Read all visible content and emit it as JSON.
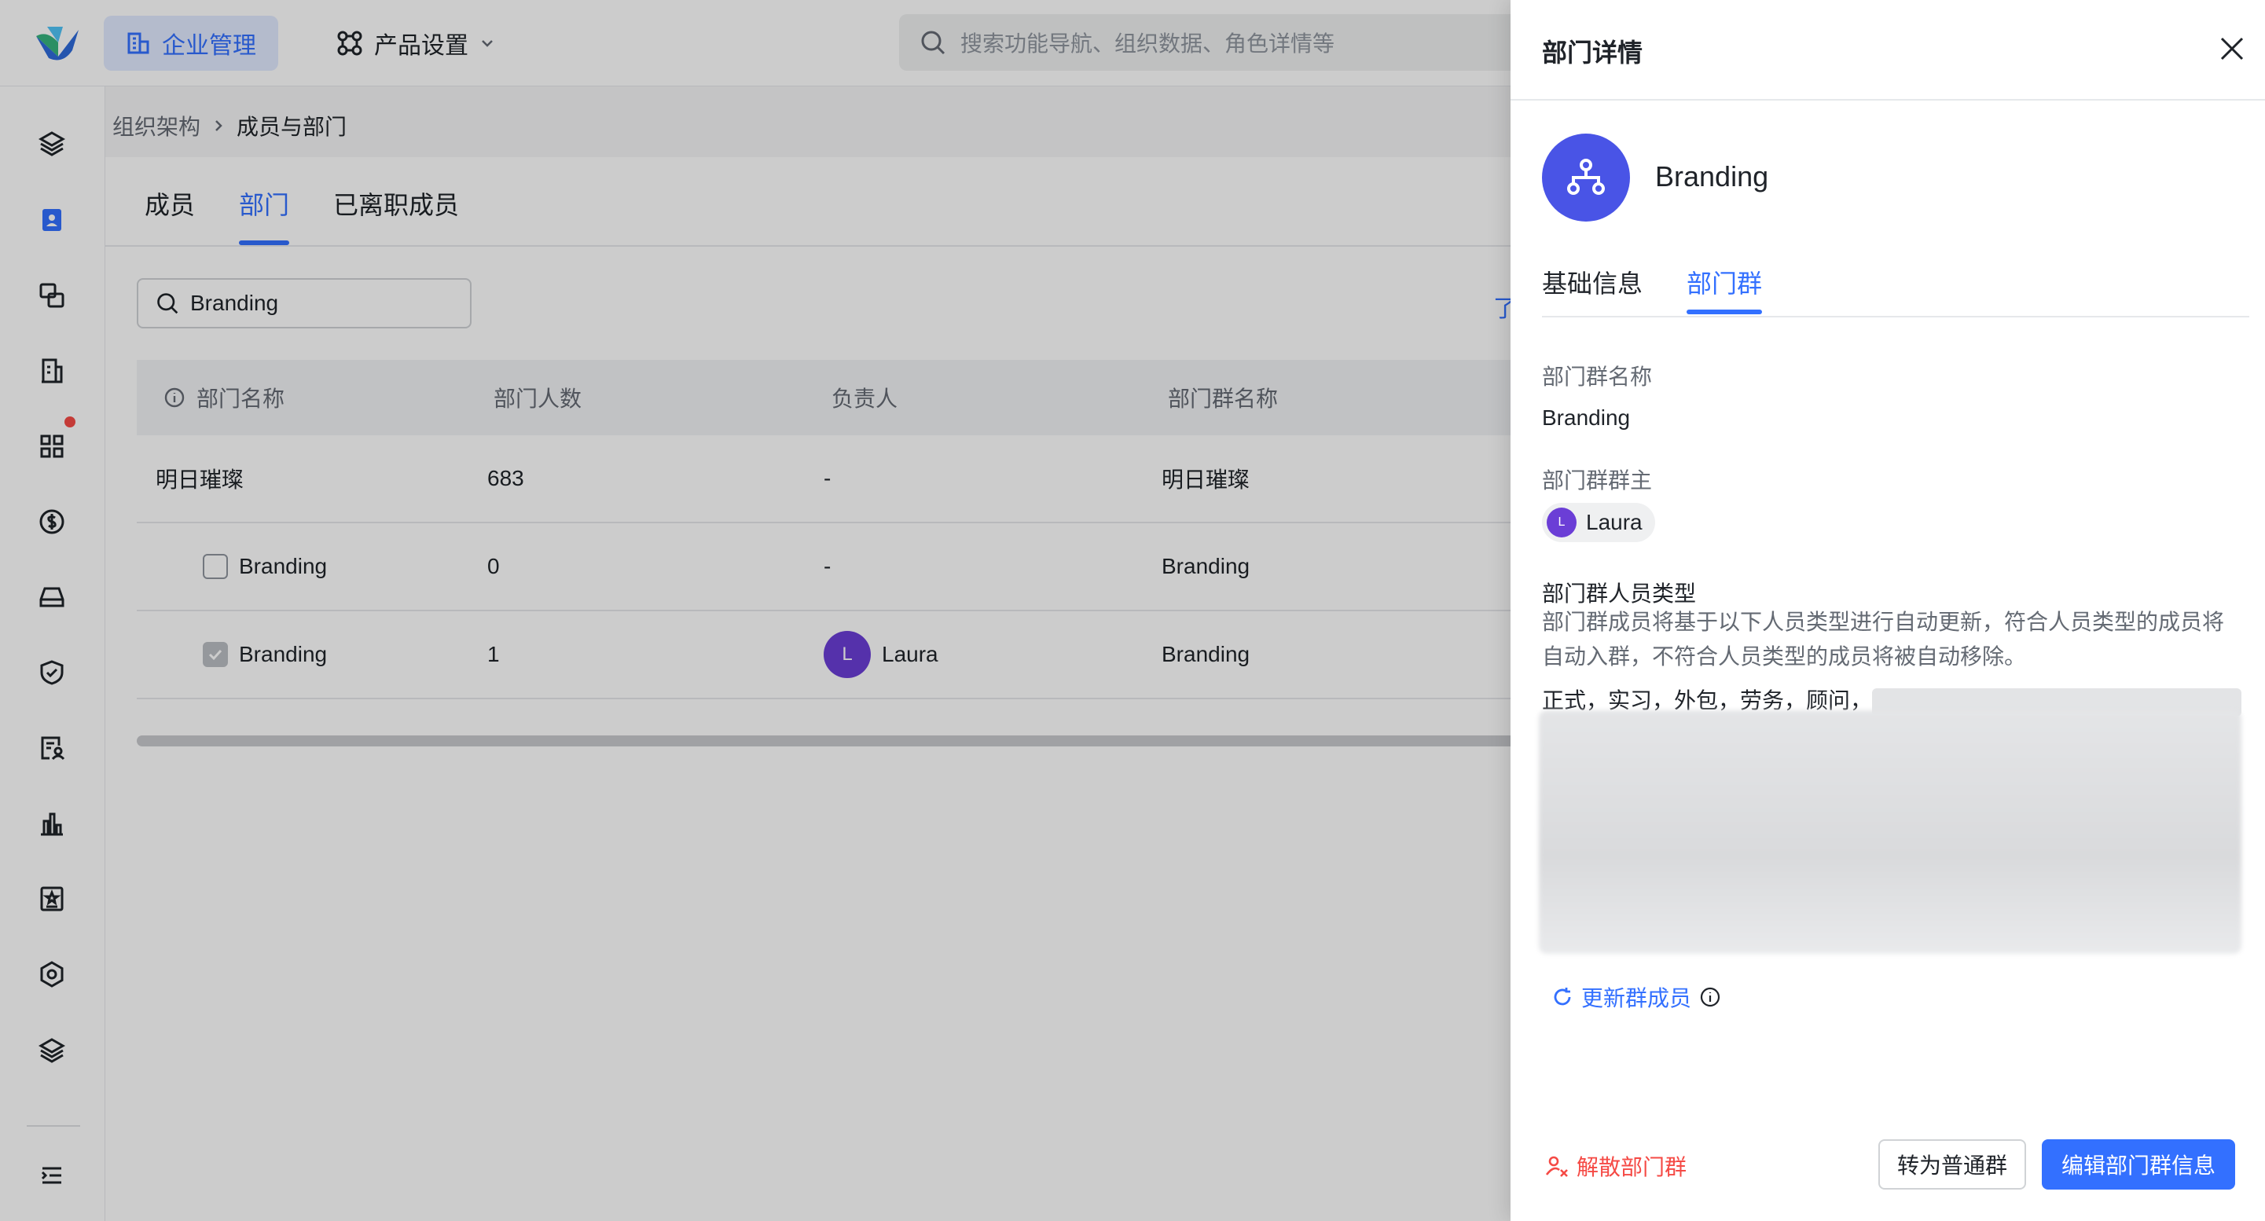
{
  "header": {
    "nav_active_label": "企业管理",
    "nav_product_label": "产品设置",
    "search_placeholder": "搜索功能导航、组织数据、角色详情等"
  },
  "breadcrumb": {
    "parent": "组织架构",
    "current": "成员与部门"
  },
  "tabs": [
    {
      "label": "成员"
    },
    {
      "label": "部门"
    },
    {
      "label": "已离职成员"
    }
  ],
  "filter": {
    "value": "Branding"
  },
  "link_peek": "了",
  "table": {
    "columns": [
      "部门名称",
      "部门人数",
      "负责人",
      "部门群名称"
    ],
    "rows": [
      {
        "name": "明日璀璨",
        "count": "683",
        "owner": "-",
        "group": "明日璀璨"
      },
      {
        "name": "Branding",
        "count": "0",
        "owner": "-",
        "group": "Branding"
      },
      {
        "name": "Branding",
        "count": "1",
        "owner": "Laura",
        "owner_initial": "L",
        "group": "Branding"
      }
    ]
  },
  "drawer": {
    "title": "部门详情",
    "dept_name": "Branding",
    "tabs": [
      {
        "label": "基础信息"
      },
      {
        "label": "部门群"
      }
    ],
    "group_name_label": "部门群名称",
    "group_name_value": "Branding",
    "group_owner_label": "部门群群主",
    "group_owner_name": "Laura",
    "group_owner_initial": "L",
    "member_type_label": "部门群人员类型",
    "member_type_desc": "部门群成员将基于以下人员类型进行自动更新，符合人员类型的成员将自动入群，不符合人员类型的成员将被自动移除。",
    "member_types": "正式，实习，外包，劳务，顾问，",
    "refresh_label": "更新群成员",
    "disband_label": "解散部门群",
    "convert_label": "转为普通群",
    "edit_label": "编辑部门群信息"
  },
  "colors": {
    "accent": "#3370ff",
    "danger": "#f54a45",
    "dept_avatar": "#4954e6",
    "user_avatar": "#6b3ed6"
  }
}
